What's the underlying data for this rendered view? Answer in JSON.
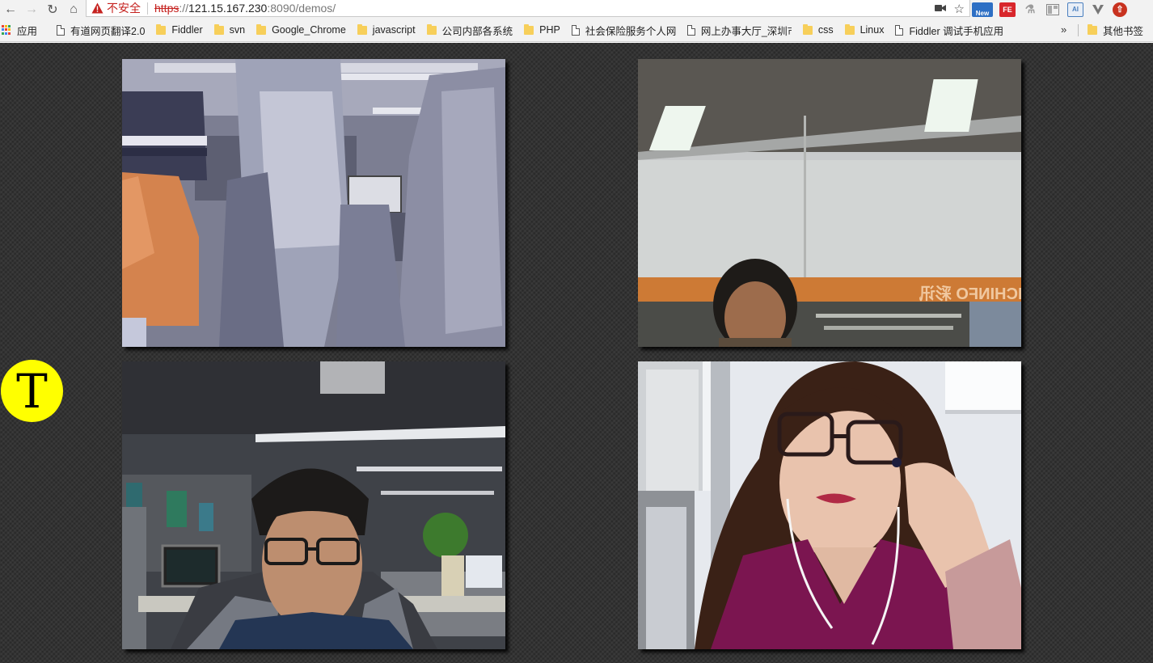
{
  "browser": {
    "security_label": "不安全",
    "url_scheme": "https",
    "url_host": "121.15.167.230",
    "url_rest": ":8090/demos/",
    "extensions": [
      {
        "icon": "news-extension-icon",
        "badge": "New",
        "color": "#2d6fc4"
      },
      {
        "icon": "fe-extension-icon",
        "badge": "FE",
        "color": "#d8262b"
      },
      {
        "icon": "flask-extension-icon",
        "badge": "",
        "color": "#9a9a9a"
      },
      {
        "icon": "layout-extension-icon",
        "badge": "",
        "color": "#8a8a8a"
      },
      {
        "icon": "ai-extension-icon",
        "badge": "AI",
        "color": "#4a7fbf"
      },
      {
        "icon": "vee-extension-icon",
        "badge": "",
        "color": "#777777"
      },
      {
        "icon": "upload-extension-icon",
        "badge": "",
        "color": "#c8321f"
      }
    ]
  },
  "bookmarks": {
    "apps_label": "应用",
    "items": [
      {
        "label": "有道网页翻译2.0",
        "type": "page"
      },
      {
        "label": "Fiddler",
        "type": "folder"
      },
      {
        "label": "svn",
        "type": "folder"
      },
      {
        "label": "Google_Chrome",
        "type": "folder"
      },
      {
        "label": "javascript",
        "type": "folder"
      },
      {
        "label": "公司内部各系统",
        "type": "folder"
      },
      {
        "label": "PHP",
        "type": "folder"
      },
      {
        "label": "社会保险服务个人网",
        "type": "page"
      },
      {
        "label": "网上办事大厅_深圳市",
        "type": "page"
      },
      {
        "label": "css",
        "type": "folder"
      },
      {
        "label": "Linux",
        "type": "folder"
      },
      {
        "label": "Fiddler 调试手机应用",
        "type": "page"
      }
    ],
    "overflow_label": "»",
    "other_label": "其他书签"
  },
  "page": {
    "badge_letter": "T",
    "video_sign_text": "RICHINFO 彩讯"
  }
}
